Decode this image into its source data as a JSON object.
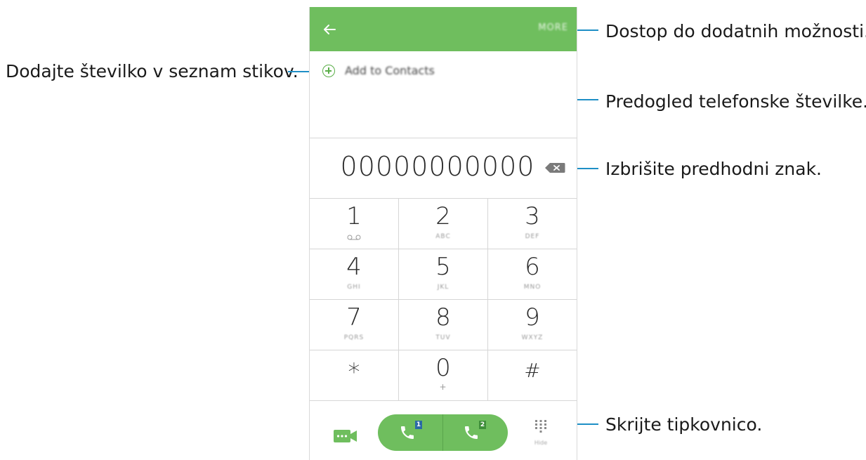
{
  "callouts": {
    "more": "Dostop do dodatnih možnosti.",
    "add_contact": "Dodajte številko v seznam stikov.",
    "preview": "Predogled telefonske številke.",
    "delete": "Izbrišite predhodni znak.",
    "hide_keypad": "Skrijte tipkovnico."
  },
  "appbar": {
    "back_icon": "arrow-left-icon",
    "more_label": "MORE",
    "color": "#6fbe5e"
  },
  "add_to_contacts": {
    "label": "Add to Contacts",
    "icon": "plus-circle-icon"
  },
  "number_display": "00000000000",
  "keypad": [
    {
      "digit": "1",
      "sub": "voicemail-icon"
    },
    {
      "digit": "2",
      "sub": "ABC"
    },
    {
      "digit": "3",
      "sub": "DEF"
    },
    {
      "digit": "4",
      "sub": "GHI"
    },
    {
      "digit": "5",
      "sub": "JKL"
    },
    {
      "digit": "6",
      "sub": "MNO"
    },
    {
      "digit": "7",
      "sub": "PQRS"
    },
    {
      "digit": "8",
      "sub": "TUV"
    },
    {
      "digit": "9",
      "sub": "WXYZ"
    },
    {
      "digit": "*",
      "sub": ""
    },
    {
      "digit": "0",
      "sub": "+"
    },
    {
      "digit": "#",
      "sub": ""
    }
  ],
  "bottom_bar": {
    "video_icon": "video-call-icon",
    "sim1_badge": "1",
    "sim2_badge": "2",
    "hide_keypad_label": "Hide"
  },
  "colors": {
    "accent": "#6fbe5e",
    "callout_line": "#1e8fc6"
  }
}
